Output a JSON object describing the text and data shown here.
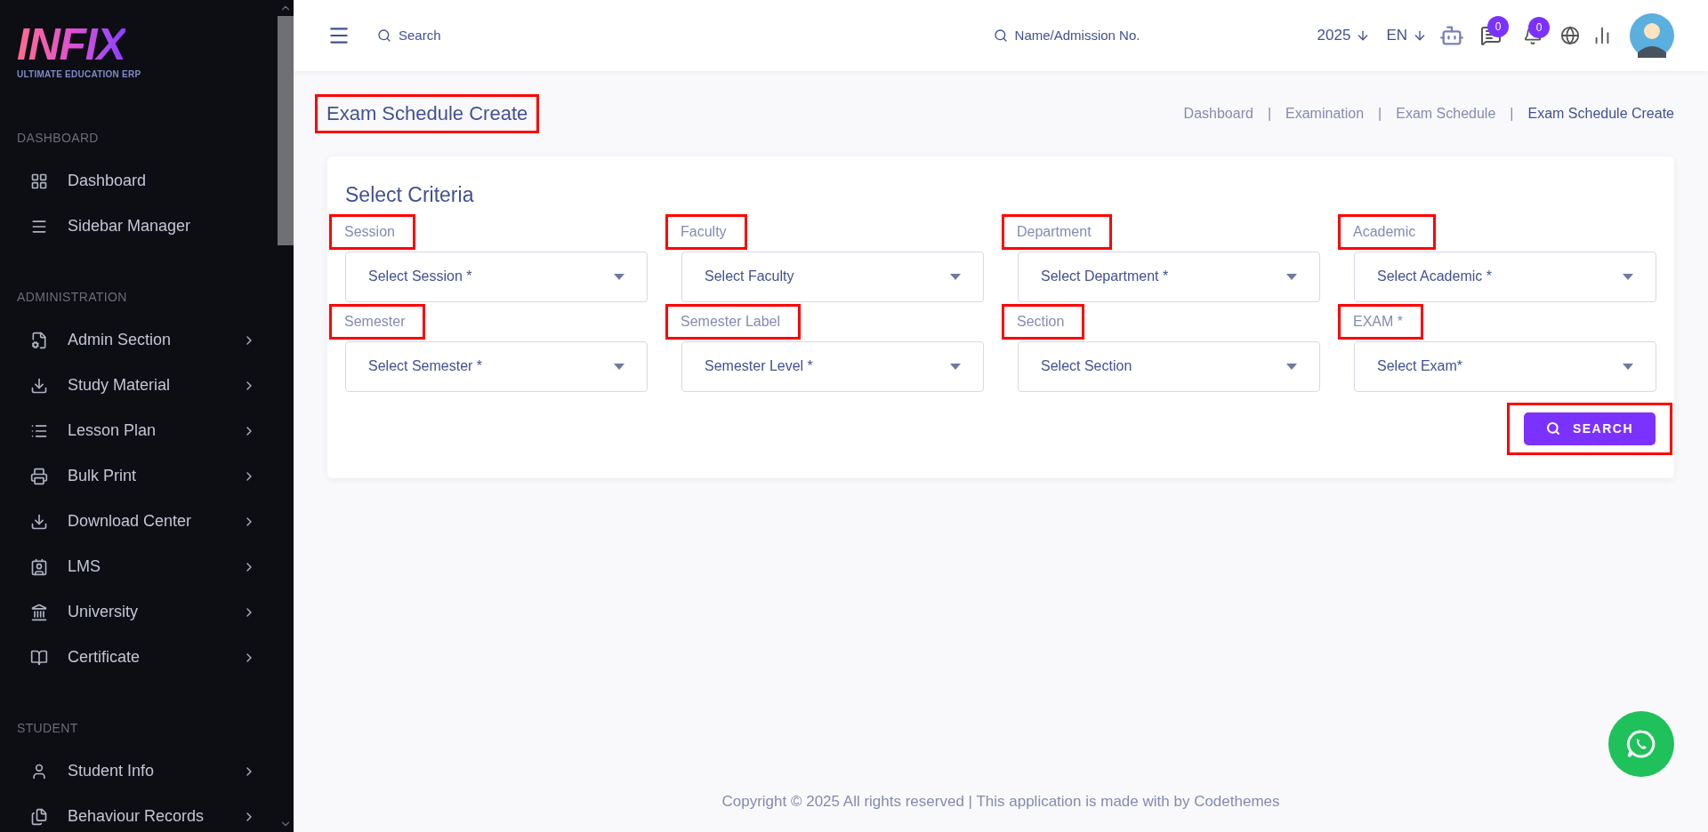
{
  "sidebar": {
    "logo": {
      "wordmark": "INFIX",
      "tagline": "ULTIMATE EDUCATION ERP"
    },
    "sections": [
      {
        "heading": "DASHBOARD",
        "items": [
          {
            "label": "Dashboard",
            "expandable": false
          },
          {
            "label": "Sidebar Manager",
            "expandable": false
          }
        ]
      },
      {
        "heading": "ADMINISTRATION",
        "items": [
          {
            "label": "Admin Section",
            "expandable": true
          },
          {
            "label": "Study Material",
            "expandable": true
          },
          {
            "label": "Lesson Plan",
            "expandable": true
          },
          {
            "label": "Bulk Print",
            "expandable": true
          },
          {
            "label": "Download Center",
            "expandable": true
          },
          {
            "label": "LMS",
            "expandable": true
          },
          {
            "label": "University",
            "expandable": true
          },
          {
            "label": "Certificate",
            "expandable": true
          }
        ]
      },
      {
        "heading": "STUDENT",
        "items": [
          {
            "label": "Student Info",
            "expandable": true
          },
          {
            "label": "Behaviour Records",
            "expandable": true
          }
        ]
      }
    ]
  },
  "header": {
    "search": {
      "placeholder": "Search"
    },
    "student_search": {
      "placeholder": "Name/Admission No."
    },
    "year": "2025",
    "language": "EN",
    "messages_count": "0",
    "notifications_count": "0"
  },
  "page": {
    "title": {
      "text": "Exam Schedule Create",
      "highlighted": true
    },
    "breadcrumbs": [
      {
        "label": "Dashboard",
        "selected": false
      },
      {
        "label": "Examination",
        "selected": false
      },
      {
        "label": "Exam Schedule",
        "selected": false
      },
      {
        "label": "Exam Schedule Create",
        "selected": true
      }
    ],
    "breadcrumb_separator": "|",
    "criteria": {
      "title": "Select Criteria",
      "fields": [
        {
          "label": "Session",
          "placeholder": "Select Session *",
          "highlighted": true
        },
        {
          "label": "Faculty",
          "placeholder": "Select Faculty",
          "highlighted": true
        },
        {
          "label": "Department",
          "placeholder": "Select Department *",
          "highlighted": true
        },
        {
          "label": "Academic",
          "placeholder": "Select Academic *",
          "highlighted": true
        },
        {
          "label": "Semester",
          "placeholder": "Select Semester *",
          "highlighted": true
        },
        {
          "label": "Semester Label",
          "placeholder": "Semester Level *",
          "highlighted": true
        },
        {
          "label": "Section",
          "placeholder": "Select Section",
          "highlighted": true
        },
        {
          "label": "EXAM *",
          "placeholder": "Select Exam*",
          "highlighted": true
        }
      ],
      "search_button": {
        "label": "SEARCH",
        "highlighted": true
      }
    }
  },
  "footer": "Copyright © 2025 All rights reserved | This application is made with by Codethemes"
}
